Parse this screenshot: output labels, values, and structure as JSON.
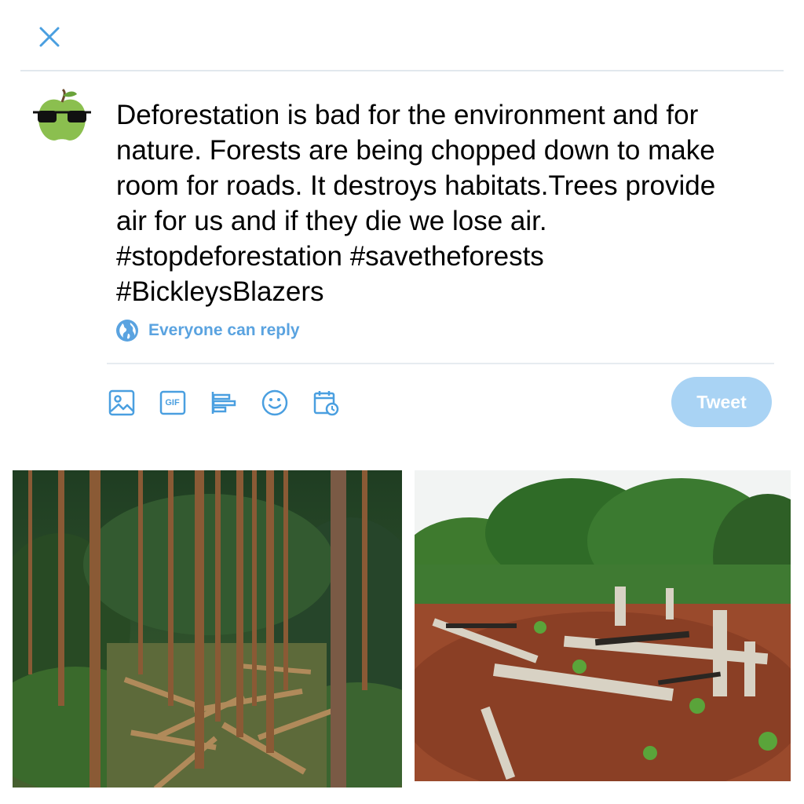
{
  "compose": {
    "close_icon": "close-icon",
    "avatar_icon": "green-apple-with-glasses",
    "text_lines": [
      "Deforestation is bad for the environment and for",
      "nature. Forests are being chopped down to make",
      "room for roads. It destroys habitats.Trees provide",
      "air for us and if they die we lose air.",
      "#stopdeforestation #savetheforests",
      "#BickleysBlazers"
    ],
    "reply_setting": {
      "icon": "globe-icon",
      "label": "Everyone can reply"
    },
    "toolbar": {
      "media_icon": "image-icon",
      "gif_label": "GIF",
      "poll_icon": "poll-icon",
      "emoji_icon": "emoji-icon",
      "schedule_icon": "schedule-icon"
    },
    "tweet_button_label": "Tweet"
  },
  "colors": {
    "accent": "#1d9bf0",
    "toolbar_icon": "#4a9fe0",
    "tweet_button_disabled": "#a9d3f4",
    "reply_label": "#5aa3e0"
  },
  "attachments": [
    {
      "name": "forest-cut-logs-photo"
    },
    {
      "name": "cleared-forest-stumps-photo"
    }
  ]
}
